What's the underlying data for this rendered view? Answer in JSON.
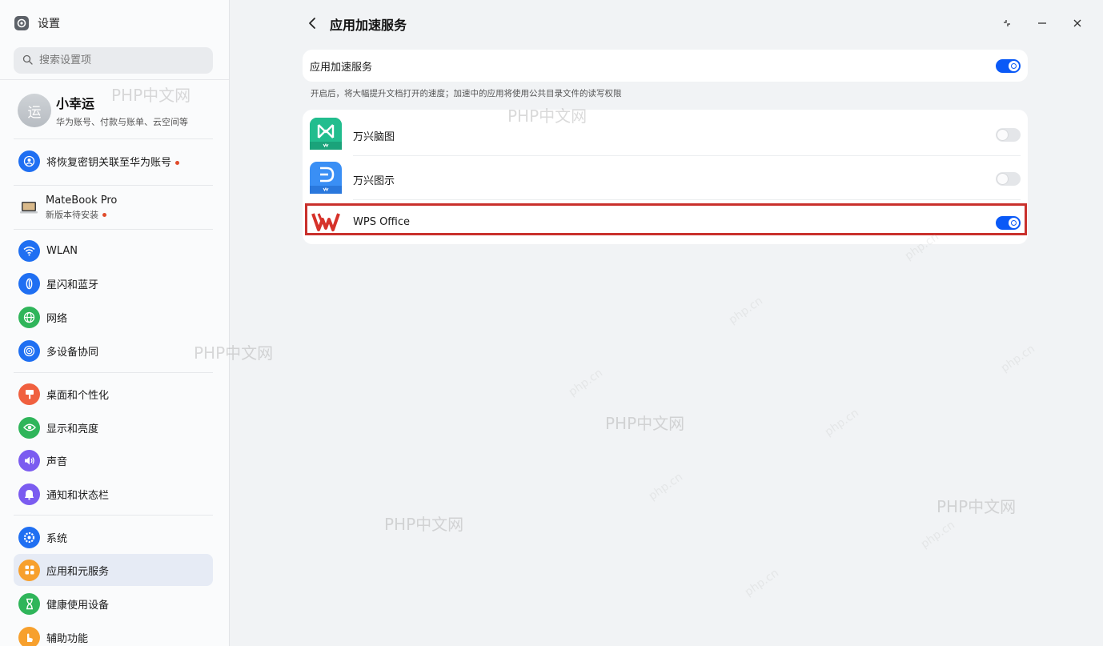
{
  "app": {
    "title": "设置"
  },
  "search": {
    "placeholder": "搜索设置项"
  },
  "profile": {
    "avatar_text": "运",
    "name": "小幸运",
    "subtitle": "华为账号、付款与账单、云空间等"
  },
  "sidebar": {
    "recovery_item": "将恢复密钥关联至华为账号",
    "device": {
      "name": "MateBook Pro",
      "status": "新版本待安装"
    },
    "items": [
      {
        "label": "WLAN",
        "icon": "wifi-icon",
        "color": "#1f6ff2"
      },
      {
        "label": "星闪和蓝牙",
        "icon": "bluetooth-icon",
        "color": "#1f6ff2"
      },
      {
        "label": "网络",
        "icon": "globe-icon",
        "color": "#2fb55a"
      },
      {
        "label": "多设备协同",
        "icon": "multidevice-icon",
        "color": "#1f6ff2"
      },
      {
        "label": "桌面和个性化",
        "icon": "brush-icon",
        "color": "#f0603f"
      },
      {
        "label": "显示和亮度",
        "icon": "eye-icon",
        "color": "#2fb55a"
      },
      {
        "label": "声音",
        "icon": "speaker-icon",
        "color": "#7b5cf0"
      },
      {
        "label": "通知和状态栏",
        "icon": "bell-icon",
        "color": "#7b5cf0"
      },
      {
        "label": "系统",
        "icon": "gear-icon",
        "color": "#1f6ff2"
      },
      {
        "label": "应用和元服务",
        "icon": "apps-icon",
        "color": "#f7a02d"
      },
      {
        "label": "健康使用设备",
        "icon": "hourglass-icon",
        "color": "#2fb55a"
      },
      {
        "label": "辅助功能",
        "icon": "hand-icon",
        "color": "#f7a02d"
      }
    ]
  },
  "main": {
    "title": "应用加速服务",
    "master_toggle_label": "应用加速服务",
    "master_toggle_on": true,
    "description": "开启后，将大幅提升文档打开的速度；加速中的应用将使用公共目录文件的读写权限",
    "apps": [
      {
        "name": "万兴脑图",
        "enabled": false
      },
      {
        "name": "万兴图示",
        "enabled": false
      },
      {
        "name": "WPS Office",
        "enabled": true
      }
    ]
  },
  "watermark": {
    "text": "PHP中文网",
    "small_text": "php.cn"
  },
  "colors": {
    "accent": "#0a59f7",
    "highlight": "#c9302c"
  }
}
